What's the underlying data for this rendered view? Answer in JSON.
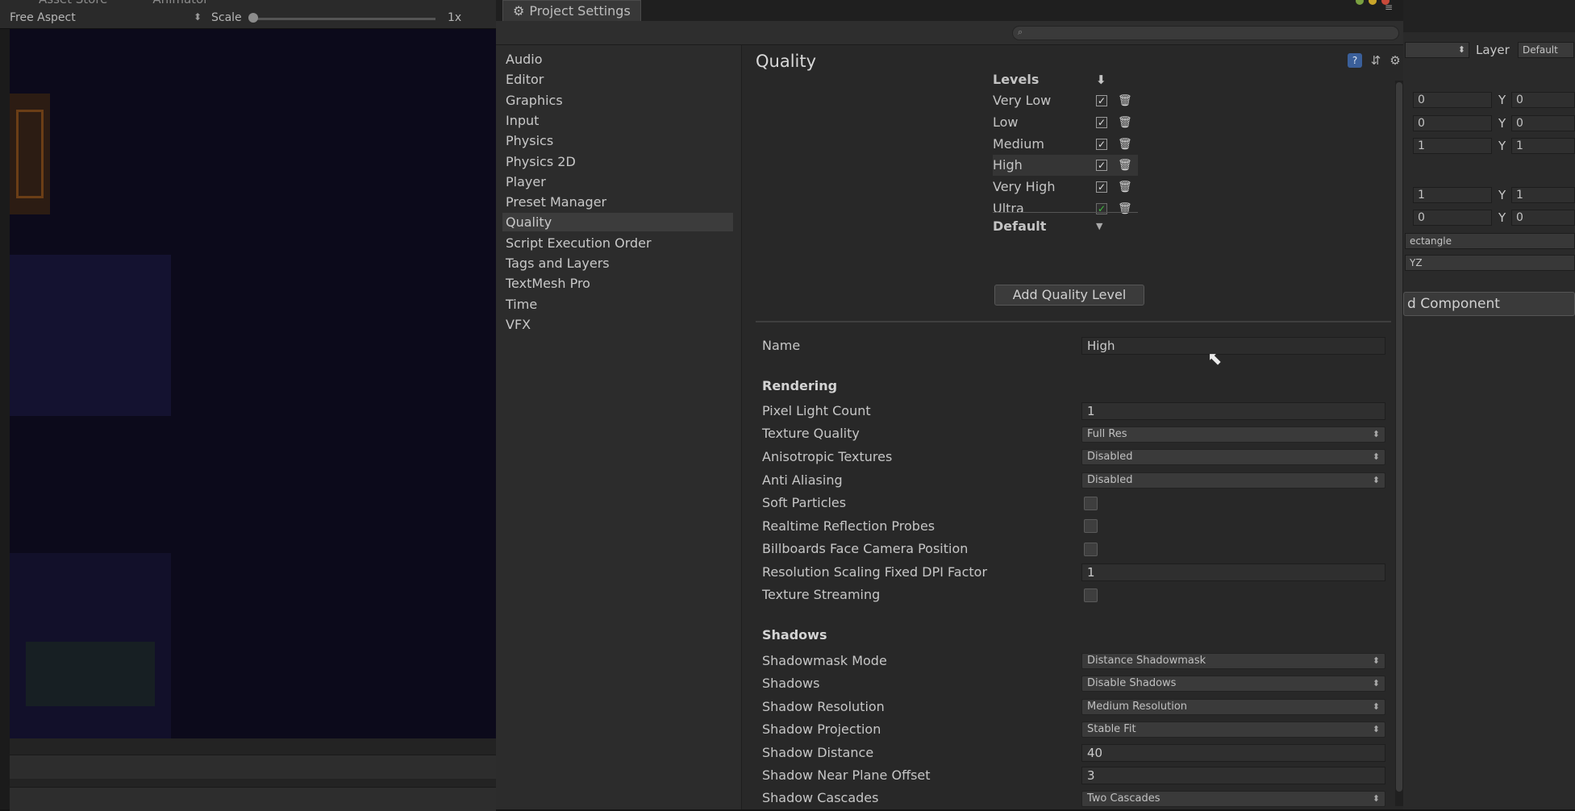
{
  "game_view": {
    "tabs": [
      "Asset Store",
      "Animator"
    ],
    "aspect": "Free Aspect",
    "scale_label": "Scale",
    "scale_value": "1x"
  },
  "window": {
    "tab_title": "Project Settings",
    "sidebar": [
      "Audio",
      "Editor",
      "Graphics",
      "Input",
      "Physics",
      "Physics 2D",
      "Player",
      "Preset Manager",
      "Quality",
      "Script Execution Order",
      "Tags and Layers",
      "TextMesh Pro",
      "Time",
      "VFX"
    ],
    "selected_item": "Quality",
    "toolbar_icons": [
      "help-icon",
      "preset-icon",
      "settings-gear-icon"
    ]
  },
  "quality": {
    "title": "Quality",
    "levels_header": "Levels",
    "levels": [
      {
        "name": "Very Low",
        "checked": true
      },
      {
        "name": "Low",
        "checked": true
      },
      {
        "name": "Medium",
        "checked": true
      },
      {
        "name": "High",
        "checked": true,
        "selected": true
      },
      {
        "name": "Very High",
        "checked": true
      },
      {
        "name": "Ultra",
        "checked": true,
        "green": true
      }
    ],
    "default_label": "Default",
    "add_level_button": "Add Quality Level",
    "name_label": "Name",
    "name_value": "High",
    "rendering": {
      "header": "Rendering",
      "pixel_light_count": {
        "label": "Pixel Light Count",
        "value": "1"
      },
      "texture_quality": {
        "label": "Texture Quality",
        "value": "Full Res"
      },
      "anisotropic": {
        "label": "Anisotropic Textures",
        "value": "Disabled"
      },
      "anti_aliasing": {
        "label": "Anti Aliasing",
        "value": "Disabled"
      },
      "soft_particles": {
        "label": "Soft Particles",
        "checked": false
      },
      "realtime_reflection": {
        "label": "Realtime Reflection Probes",
        "checked": false
      },
      "billboards": {
        "label": "Billboards Face Camera Position",
        "checked": false
      },
      "dpi_factor": {
        "label": "Resolution Scaling Fixed DPI Factor",
        "value": "1"
      },
      "texture_streaming": {
        "label": "Texture Streaming",
        "checked": false
      }
    },
    "shadows": {
      "header": "Shadows",
      "shadowmask_mode": {
        "label": "Shadowmask Mode",
        "value": "Distance Shadowmask"
      },
      "shadows": {
        "label": "Shadows",
        "value": "Disable Shadows"
      },
      "resolution": {
        "label": "Shadow Resolution",
        "value": "Medium Resolution"
      },
      "projection": {
        "label": "Shadow Projection",
        "value": "Stable Fit"
      },
      "distance": {
        "label": "Shadow Distance",
        "value": "40"
      },
      "near_plane": {
        "label": "Shadow Near Plane Offset",
        "value": "3"
      },
      "cascades": {
        "label": "Shadow Cascades",
        "value": "Two Cascades"
      }
    }
  },
  "inspector": {
    "layer_label": "Layer",
    "layer_value": "Default",
    "rows": [
      {
        "x": "0",
        "y_label": "Y",
        "y": "0"
      },
      {
        "x": "0",
        "y_label": "Y",
        "y": "0"
      },
      {
        "x": "1",
        "y_label": "Y",
        "y": "1"
      },
      {
        "x": "1",
        "y_label": "Y",
        "y": "1"
      },
      {
        "x": "0",
        "y_label": "Y",
        "y": "0"
      }
    ],
    "shape_value": "ectangle",
    "axis_value": "YZ",
    "add_component": "d Component"
  }
}
